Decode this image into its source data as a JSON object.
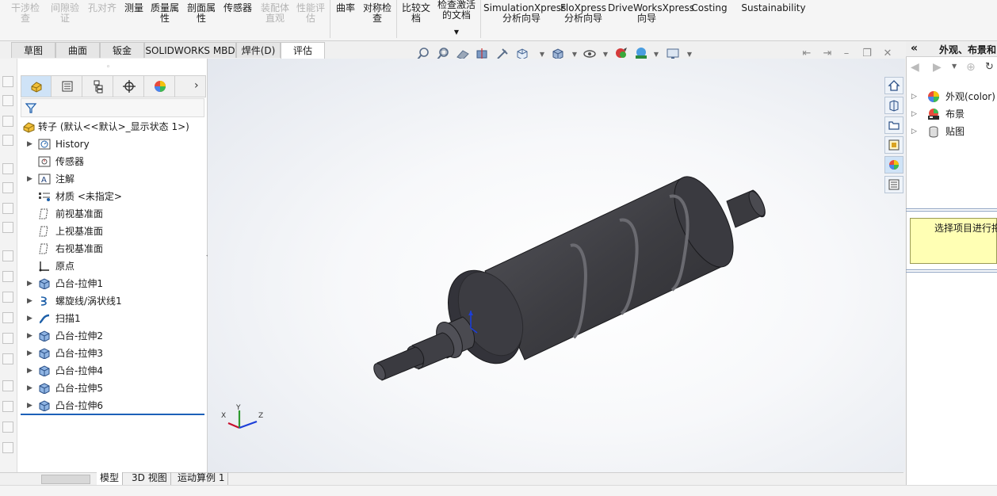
{
  "ribbon": {
    "items": [
      {
        "label": "干涉检\n查",
        "disabled": true
      },
      {
        "label": "间隙验\n证",
        "disabled": true
      },
      {
        "label": "孔对齐",
        "disabled": true
      },
      {
        "label": "测量",
        "disabled": false
      },
      {
        "label": "质量属\n性",
        "disabled": false
      },
      {
        "label": "剖面属\n性",
        "disabled": false
      },
      {
        "label": "传感器",
        "disabled": false
      },
      {
        "label": "装配体\n直观",
        "disabled": true
      },
      {
        "label": "性能评\n估",
        "disabled": true
      },
      {
        "label": "曲率",
        "disabled": false
      },
      {
        "label": "对称检\n查",
        "disabled": false
      },
      {
        "label": "比较文\n档",
        "disabled": false
      },
      {
        "label": "检查激活\n的文档",
        "disabled": false
      },
      {
        "label": "SimulationXpress\n分析向导",
        "disabled": false
      },
      {
        "label": "FloXpress\n分析向导",
        "disabled": false
      },
      {
        "label": "DriveWorksXpress\n向导",
        "disabled": false
      },
      {
        "label": "Costing",
        "disabled": false
      },
      {
        "label": "Sustainability",
        "disabled": false
      }
    ]
  },
  "tabs": [
    "草图",
    "曲面",
    "钣金",
    "SOLIDWORKS MBD",
    "焊件(D)",
    "评估"
  ],
  "active_tab": "评估",
  "tree": {
    "root": "转子  (默认<<默认>_显示状态 1>)",
    "items": [
      {
        "label": "History",
        "expandable": true,
        "icon": "history-icon"
      },
      {
        "label": "传感器",
        "expandable": false,
        "icon": "sensor-icon"
      },
      {
        "label": "注解",
        "expandable": true,
        "icon": "annotation-icon"
      },
      {
        "label": "材质 <未指定>",
        "expandable": false,
        "icon": "material-icon"
      },
      {
        "label": "前视基准面",
        "expandable": false,
        "icon": "plane-icon"
      },
      {
        "label": "上视基准面",
        "expandable": false,
        "icon": "plane-icon"
      },
      {
        "label": "右视基准面",
        "expandable": false,
        "icon": "plane-icon"
      },
      {
        "label": "原点",
        "expandable": false,
        "icon": "origin-icon"
      },
      {
        "label": "凸台-拉伸1",
        "expandable": true,
        "icon": "extrude-icon"
      },
      {
        "label": "螺旋线/涡状线1",
        "expandable": true,
        "icon": "helix-icon"
      },
      {
        "label": "扫描1",
        "expandable": true,
        "icon": "sweep-icon"
      },
      {
        "label": "凸台-拉伸2",
        "expandable": true,
        "icon": "extrude-icon"
      },
      {
        "label": "凸台-拉伸3",
        "expandable": true,
        "icon": "extrude-icon"
      },
      {
        "label": "凸台-拉伸4",
        "expandable": true,
        "icon": "extrude-icon"
      },
      {
        "label": "凸台-拉伸5",
        "expandable": true,
        "icon": "extrude-icon"
      },
      {
        "label": "凸台-拉伸6",
        "expandable": true,
        "icon": "extrude-icon"
      }
    ]
  },
  "taskpane": {
    "title": "外观、布景和",
    "items": [
      {
        "label": "外观(color)",
        "icon": "appearance-icon"
      },
      {
        "label": "布景",
        "icon": "scene-icon"
      },
      {
        "label": "贴图",
        "icon": "decal-icon"
      }
    ],
    "hint": "选择项目进行拖"
  },
  "triad": {
    "x": "X",
    "y": "Y",
    "z": "Z"
  },
  "bottom_tabs": [
    "模型",
    "3D 视图",
    "运动算例 1"
  ],
  "active_bottom_tab": "模型",
  "colors": {
    "accent": "#1c60b8",
    "part": "#3c3c41",
    "hint_bg": "#ffffb4"
  }
}
